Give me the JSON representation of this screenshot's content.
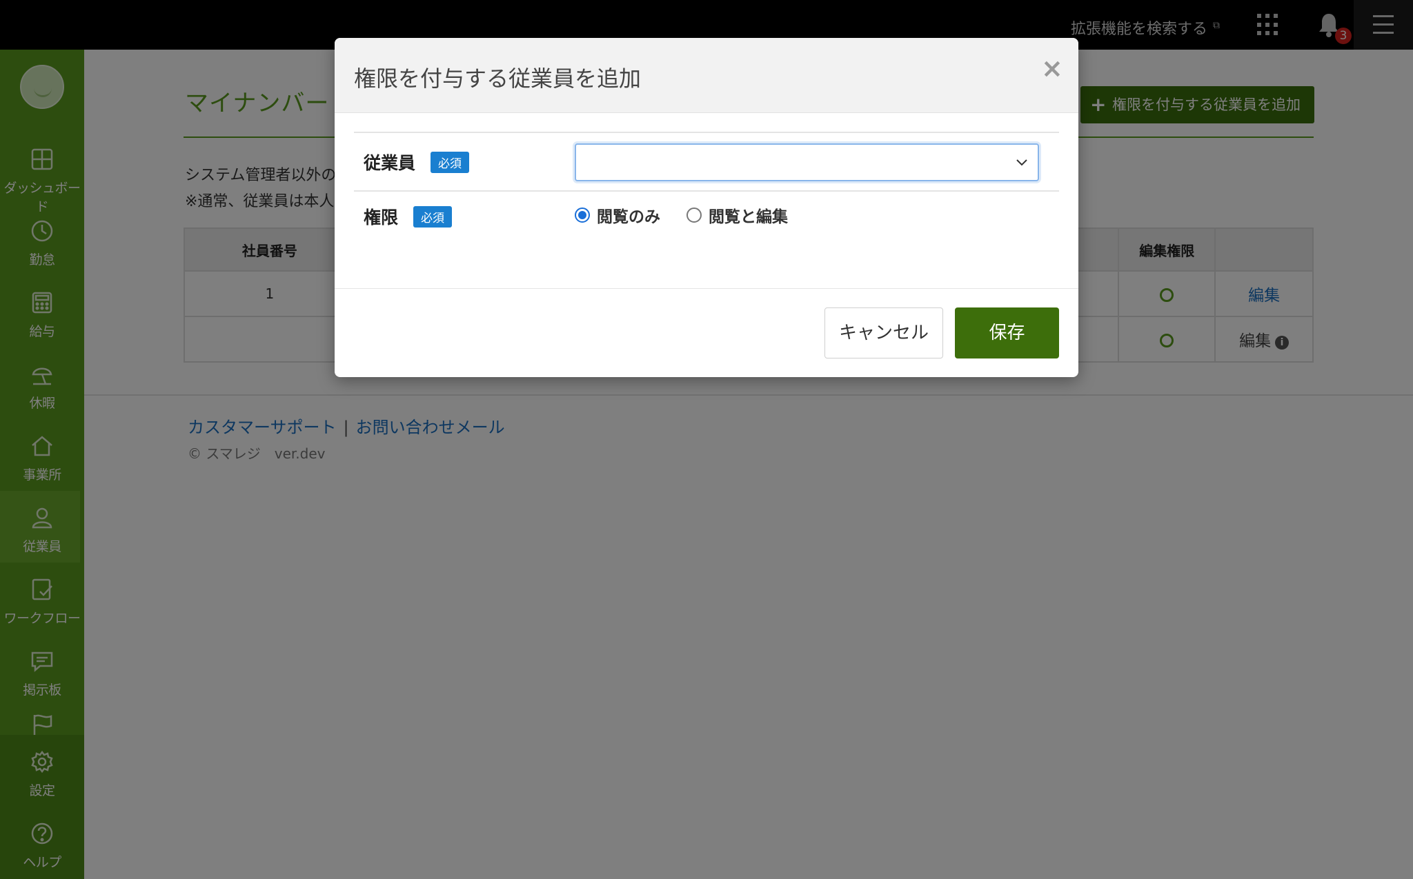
{
  "topbar": {
    "extension_link": "拡張機能を検索する",
    "notification_count": "3"
  },
  "sidebar": {
    "items": [
      {
        "label": "ダッシュボード",
        "icon": "dashboard-icon"
      },
      {
        "label": "勤怠",
        "icon": "clock-icon"
      },
      {
        "label": "給与",
        "icon": "calculator-icon"
      },
      {
        "label": "休暇",
        "icon": "umbrella-icon"
      },
      {
        "label": "事業所",
        "icon": "home-icon"
      },
      {
        "label": "従業員",
        "icon": "user-icon"
      },
      {
        "label": "ワークフロー",
        "icon": "checklist-icon"
      },
      {
        "label": "掲示板",
        "icon": "chat-icon"
      },
      {
        "label": "",
        "icon": "flag-icon"
      },
      {
        "label": "設定",
        "icon": "gear-icon"
      },
      {
        "label": "ヘルプ",
        "icon": "help-icon"
      }
    ],
    "active": "従業員"
  },
  "page": {
    "title": "マイナンバー",
    "add_button": "権限を付与する従業員を追加",
    "desc_line1": "システム管理者以外の",
    "desc_line2": "※通常、従業員は本人"
  },
  "table": {
    "headers": {
      "employee_no": "社員番号",
      "edit_permission": "編集権限"
    },
    "rows": [
      {
        "employee_no": "1",
        "edit": "編集"
      },
      {
        "employee_no": "",
        "edit": "編集"
      }
    ]
  },
  "footer": {
    "support": "カスタマーサポート",
    "separator": "|",
    "contact": "お問い合わせメール",
    "copyright": "© スマレジ　ver.dev"
  },
  "modal": {
    "title": "権限を付与する従業員を追加",
    "employee_label": "従業員",
    "permission_label": "権限",
    "required_badge": "必須",
    "employee_value": "",
    "radio_view_only": "閲覧のみ",
    "radio_view_edit": "閲覧と編集",
    "selected_permission": "閲覧のみ",
    "cancel": "キャンセル",
    "save": "保存"
  }
}
